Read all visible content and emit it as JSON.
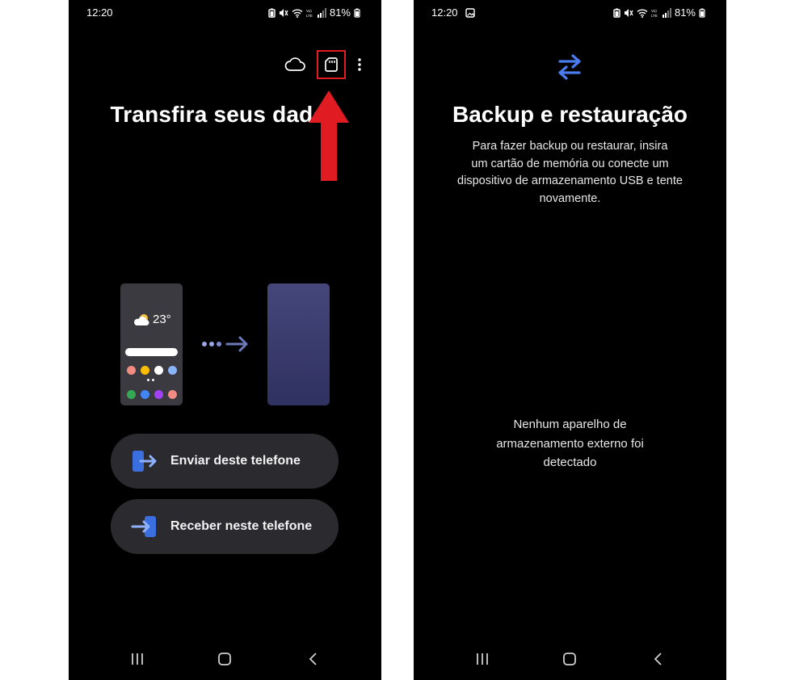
{
  "screen_left": {
    "status": {
      "time": "12:20",
      "battery": "81%"
    },
    "header": {
      "cloud_icon": "cloud-icon",
      "sd_icon": "sd-card-icon",
      "more_icon": "more-vert-icon",
      "highlight_color": "#e11b22"
    },
    "title": "Transfira seus dados",
    "illustration": {
      "temperature": "23°",
      "app_dot_colors_row1": [
        "#f28b82",
        "#fbbc04",
        "#ffffff",
        "#8ab4f8"
      ],
      "app_dot_colors_row2": [
        "#34a853",
        "#4285f4",
        "#a142f4",
        "#f28b82"
      ]
    },
    "actions": [
      {
        "label": "Enviar deste telefone",
        "icon": "send-phone-icon"
      },
      {
        "label": "Receber neste telefone",
        "icon": "receive-phone-icon"
      }
    ]
  },
  "screen_right": {
    "status": {
      "time": "12:20",
      "battery": "81%"
    },
    "icon": "swap-arrows-icon",
    "accent_color": "#4a7cf0",
    "title": "Backup e restauração",
    "description_lines": [
      "Para fazer backup ou restaurar, insira",
      "um cartão de memória ou conecte um",
      "dispositivo de armazenamento USB e tente",
      "novamente."
    ],
    "no_device_lines": [
      "Nenhum aparelho de",
      "armazenamento externo foi",
      "detectado"
    ]
  }
}
